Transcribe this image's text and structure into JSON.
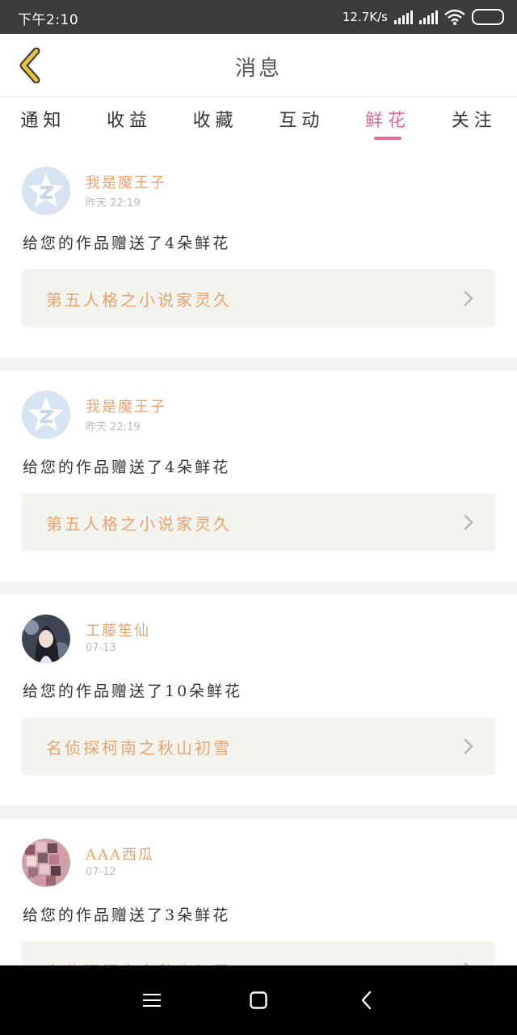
{
  "status_bar": {
    "time": "下午2:10",
    "net_speed": "12.7K/s",
    "battery": "24"
  },
  "header": {
    "title": "消息",
    "back_icon": "chevron-left-icon"
  },
  "tabs": [
    {
      "label": "通知",
      "active": false
    },
    {
      "label": "收益",
      "active": false
    },
    {
      "label": "收藏",
      "active": false
    },
    {
      "label": "互动",
      "active": false
    },
    {
      "label": "鲜花",
      "active": true
    },
    {
      "label": "关注",
      "active": false
    }
  ],
  "messages": [
    {
      "name": "我是魔王子",
      "time": "昨天 22:19",
      "text": "给您的作品赠送了4朵鲜花",
      "work": "第五人格之小说家灵久",
      "avatar": "default-avatar"
    },
    {
      "name": "我是魔王子",
      "time": "昨天 22:19",
      "text": "给您的作品赠送了4朵鲜花",
      "work": "第五人格之小说家灵久",
      "avatar": "default-avatar"
    },
    {
      "name": "工藤笙仙",
      "time": "07-13",
      "text": "给您的作品赠送了10朵鲜花",
      "work": "名侦探柯南之秋山初雪",
      "avatar": "anime-girl-avatar"
    },
    {
      "name": "AAA西瓜",
      "time": "07-12",
      "text": "给您的作品赠送了3朵鲜花",
      "work": "名侦探柯南之秋山初雪",
      "avatar": "collage-avatar"
    }
  ],
  "colors": {
    "accent": "#e0689b",
    "name": "#e8a36f",
    "link_bg": "#f4f4ef",
    "back_arrow": "#e6c53a"
  },
  "nav_bar": {
    "icons": [
      "menu-icon",
      "home-icon",
      "back-icon"
    ]
  }
}
